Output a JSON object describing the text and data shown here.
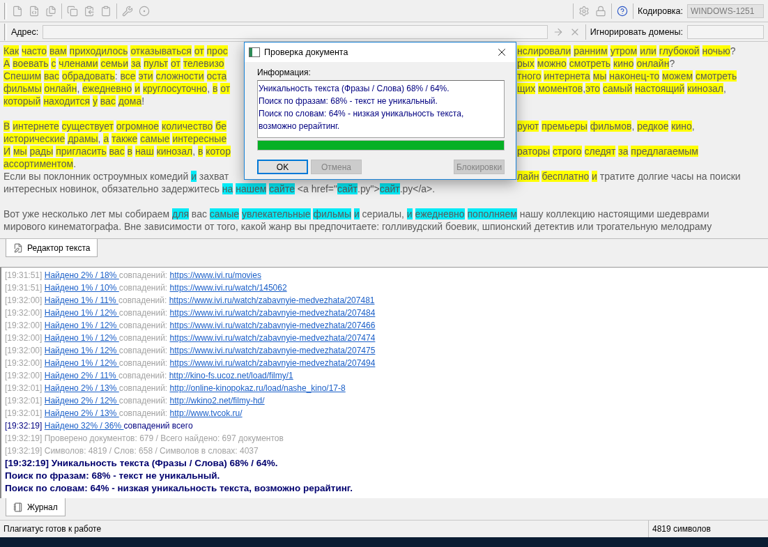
{
  "toolbar": {
    "encoding_label": "Кодировка:",
    "encoding": {
      "value": "WINDOWS-1251",
      "disabled": true
    }
  },
  "address_bar": {
    "label": "Адрес:",
    "ignore_label": "Игнорировать домены:"
  },
  "editor": {
    "lines": [
      {
        "kind": "text",
        "left": [
          {
            "text": "Как часто вам приходилось отказываться от прос",
            "color": "#ffff00"
          }
        ],
        "right": [
          {
            "text": "нслировали ранним утром или глубокой ночью?",
            "color": "#ffff00"
          }
        ]
      },
      {
        "kind": "text",
        "left": [
          {
            "text": "А воевать с членами семьи за пульт от телевизо",
            "color": "#ffff00"
          }
        ],
        "right": [
          {
            "text": "рых можно смотреть кино онлайн?",
            "color": "#ffff00"
          }
        ]
      },
      {
        "kind": "text",
        "left": [
          {
            "text": "Спешим вас обрадовать: все эти сложности оста",
            "color": "#ffff00"
          }
        ],
        "right": [
          {
            "text": "тного интернета мы наконец-то можем смотреть",
            "color": "#ffff00"
          }
        ]
      },
      {
        "kind": "text",
        "left": [
          {
            "text": "фильмы онлайн, ежедневно и круглосуточно, в от",
            "color": "#ffff00"
          }
        ],
        "right": [
          {
            "text": "щих моментов,это самый настоящий кинозал,",
            "color": "#ffff00"
          }
        ]
      },
      {
        "kind": "text",
        "left": [
          {
            "text": "который находится у вас дома!",
            "color": "#ffff00"
          }
        ]
      },
      {
        "kind": "blank"
      },
      {
        "kind": "text",
        "left": [
          {
            "text": "В интернете существует огромное количество бе",
            "color": "#ffff00"
          }
        ],
        "right": [
          {
            "text": "руют премьеры фильмов, редкое кино,",
            "color": "#ffff00"
          }
        ]
      },
      {
        "kind": "text",
        "left": [
          {
            "text": "исторические драмы, а также самые интересные",
            "color": "#ffff00"
          }
        ]
      },
      {
        "kind": "text",
        "left": [
          {
            "text": "И мы рады пригласить вас в наш кинозал, в котор",
            "color": "#ffff00"
          }
        ],
        "right": [
          {
            "text": "раторы строго следят за предлагаемым",
            "color": "#ffff00"
          }
        ]
      },
      {
        "kind": "text",
        "left": [
          {
            "text": "ассортиментом.",
            "color": "#ffff00"
          }
        ]
      },
      {
        "kind": "text",
        "left": [
          {
            "text": "Если вы поклонник остроумных комедий "
          },
          {
            "text": "и",
            "color": "#00eaf6"
          },
          {
            "text": " захват"
          }
        ],
        "right": [
          {
            "text": "лайн бесплатно и",
            "color": "#ffff00"
          },
          {
            "text": " тратите долгие часы на поиски"
          }
        ]
      },
      {
        "kind": "text",
        "full": [
          {
            "text": "интересных новинок, обязательно задержитесь "
          },
          {
            "text": "на нашем сайте",
            "color": "#00eaf6"
          },
          {
            "text": " <a href=\""
          },
          {
            "text": "сайт",
            "color": "#00eaf6"
          },
          {
            "text": ".ру\">"
          },
          {
            "text": "сайт",
            "color": "#00eaf6"
          },
          {
            "text": ".ру</a>."
          }
        ]
      },
      {
        "kind": "blank"
      },
      {
        "kind": "text",
        "full": [
          {
            "text": "Вот уже несколько лет мы собираем "
          },
          {
            "text": "для",
            "color": "#00eaf6"
          },
          {
            "text": " вас "
          },
          {
            "text": "самые увлекательные фильмы и",
            "color": "#00eaf6"
          },
          {
            "text": " сериалы, "
          },
          {
            "text": "и ежедневно пополняем",
            "color": "#00eaf6"
          },
          {
            "text": " нашу коллекцию настоящими шедеврами"
          }
        ]
      },
      {
        "kind": "text",
        "full": [
          {
            "text": "мирового кинематографа. Вне зависимости от того, какой жанр вы предпочитаете: голливудский боевик, шпионский детектив или трогательную мелодраму"
          }
        ]
      }
    ]
  },
  "editor_tabs": [
    {
      "label": "Редактор текста",
      "selected": true
    }
  ],
  "log": {
    "entries": [
      {
        "kind": "match",
        "time": "[19:31:51]",
        "found": "Найдено 2% / 18% ",
        "label": "совпадений:",
        "url": "https://www.ivi.ru/movies"
      },
      {
        "kind": "match",
        "time": "[19:31:51]",
        "found": "Найдено 1% / 10% ",
        "label": "совпадений:",
        "url": "https://www.ivi.ru/watch/145062"
      },
      {
        "kind": "match",
        "time": "[19:32:00]",
        "found": "Найдено 1% / 11% ",
        "label": "совпадений:",
        "url": "https://www.ivi.ru/watch/zabavnyie-medvezhata/207481"
      },
      {
        "kind": "match",
        "time": "[19:32:00]",
        "found": "Найдено 1% / 12% ",
        "label": "совпадений:",
        "url": "https://www.ivi.ru/watch/zabavnyie-medvezhata/207484"
      },
      {
        "kind": "match",
        "time": "[19:32:00]",
        "found": "Найдено 1% / 12% ",
        "label": "совпадений:",
        "url": "https://www.ivi.ru/watch/zabavnyie-medvezhata/207466"
      },
      {
        "kind": "match",
        "time": "[19:32:00]",
        "found": "Найдено 1% / 12% ",
        "label": "совпадений:",
        "url": "https://www.ivi.ru/watch/zabavnyie-medvezhata/207474"
      },
      {
        "kind": "match",
        "time": "[19:32:00]",
        "found": "Найдено 1% / 12% ",
        "label": "совпадений:",
        "url": "https://www.ivi.ru/watch/zabavnyie-medvezhata/207475"
      },
      {
        "kind": "match",
        "time": "[19:32:00]",
        "found": "Найдено 1% / 12% ",
        "label": "совпадений:",
        "url": "https://www.ivi.ru/watch/zabavnyie-medvezhata/207494"
      },
      {
        "kind": "match",
        "time": "[19:32:00]",
        "found": "Найдено 2% / 11% ",
        "label": "совпадений:",
        "url": "http://kino-fs.ucoz.net/load/filmy/1"
      },
      {
        "kind": "match",
        "time": "[19:32:01]",
        "found": "Найдено 2% / 13% ",
        "label": "совпадений:",
        "url": "http://online-kinopokaz.ru/load/nashe_kino/17-8"
      },
      {
        "kind": "match",
        "time": "[19:32:01]",
        "found": "Найдено 2% / 12% ",
        "label": "совпадений:",
        "url": "http://wkino2.net/filmy-hd/"
      },
      {
        "kind": "match",
        "time": "[19:32:01]",
        "found": "Найдено 2% / 13% ",
        "label": "совпадений:",
        "url": "http://www.tvcok.ru/"
      },
      {
        "kind": "total",
        "time": "[19:32:19]",
        "found": "Найдено 32% / 36% ",
        "label": "совпадений всего"
      },
      {
        "kind": "info",
        "text": "[19:32:19] Проверено документов: 679  / Всего найдено: 697 документов"
      },
      {
        "kind": "info",
        "text": "[19:32:19] Символов: 4819 / Слов: 658 / Символов в словах: 4037"
      },
      {
        "kind": "result",
        "text": "[19:32:19] Уникальность текста (Фразы / Слова) 68% / 64%."
      },
      {
        "kind": "result",
        "text": "Поиск по фразам: 68% - текст не уникальный."
      },
      {
        "kind": "result",
        "text": "Поиск по словам: 64% - низкая уникальность текста, возможно рерайтинг."
      }
    ]
  },
  "log_tabs": [
    {
      "label": "Журнал",
      "selected": true
    }
  ],
  "status_bar": {
    "message": "Плагиатус готов к работе",
    "count": "4819 символов"
  },
  "dialog": {
    "title": "Проверка документа",
    "info_label": "Информация:",
    "info_lines": [
      "Уникальность текста (Фразы / Слова) 68% / 64%.",
      "Поиск по фразам: 68% - текст не уникальный.",
      "Поиск по словам: 64% - низкая уникальность текста,",
      "возможно рерайтинг."
    ],
    "progress": {
      "level": 1
    },
    "buttons": [
      {
        "label": "OK",
        "disabled": false,
        "focused": true
      },
      {
        "label": "Отмена",
        "disabled": true,
        "focused": false
      },
      {
        "label": "Блокировки",
        "disabled": true,
        "focused": false
      }
    ]
  }
}
